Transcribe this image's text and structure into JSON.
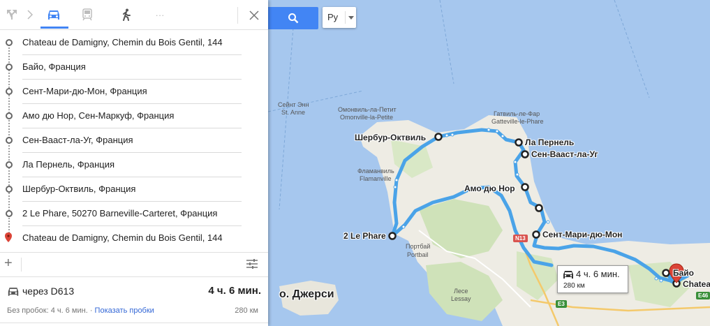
{
  "modes": {
    "directions_icon": "fork-icon",
    "car": "car-icon",
    "transit": "train-icon",
    "walk": "walk-icon",
    "more": "···"
  },
  "stops": [
    {
      "label": "Chateau de Damigny, Chemin du Bois Gentil, 144"
    },
    {
      "label": "Байо, Франция"
    },
    {
      "label": "Сент-Мари-дю-Мон, Франция"
    },
    {
      "label": "Амо дю Нор, Сен-Маркуф, Франция"
    },
    {
      "label": "Сен-Вааст-ла-Уг, Франция"
    },
    {
      "label": "Ла Пернель, Франция"
    },
    {
      "label": "Шербур-Октвиль, Франция"
    },
    {
      "label": "2 Le Phare, 50270 Barneville-Carteret, Франция"
    },
    {
      "label": "Chateau de Damigny, Chemin du Bois Gentil, 144"
    }
  ],
  "toolbar": {
    "add": "+"
  },
  "route": {
    "via": "через D613",
    "time": "4 ч. 6 мин.",
    "no_traffic": "Без пробок: 4 ч. 6 мин. · ",
    "show_traffic": "Показать пробки",
    "distance": "280 км"
  },
  "lang": {
    "code": "Ру"
  },
  "map": {
    "labels": {
      "saint_anne_ru": "Сейнт Энн",
      "saint_anne": "St. Anne",
      "omonville_ru": "Омонвиль-ла-Петит",
      "omonville": "Omonville-la-Petite",
      "gatteville_ru": "Гатвиль-ле-Фар",
      "gatteville": "Gatteville-le-Phare",
      "flamanville_ru": "Фламанвиль",
      "flamanville": "Flamanville",
      "portbail_ru": "Портбай",
      "portbail": "Portbail",
      "lessay_ru": "Лесе",
      "lessay": "Lessay",
      "n13": "N13",
      "e3": "E3",
      "e46": "E46"
    },
    "cities": {
      "cherbourg": "Шербур-Октвиль",
      "la_pernelle": "Ла Пернель",
      "vaast": "Сен-Вааст-ла-Уг",
      "hameau": "Амо дю Нор",
      "le_phare": "2 Le Phare",
      "sainte_marie": "Сент-Мари-дю-Мон",
      "bayeux": "Байо",
      "chateau": "Chateau"
    },
    "island": "о. Джерси"
  },
  "callout": {
    "time": "4 ч. 6 мин.",
    "distance": "280 км"
  },
  "colors": {
    "route": "#4aa3e8",
    "water": "#a6c7ee",
    "land": "#eeece4",
    "accent": "#4285f4"
  }
}
